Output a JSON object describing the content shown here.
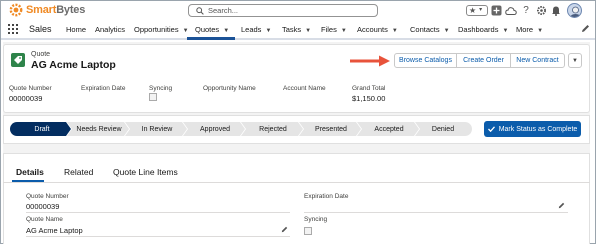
{
  "header": {
    "logo_text_orange": "Smart",
    "logo_text_gray": "Bytes",
    "search_placeholder": "Search...",
    "icons": [
      "favorites-star-icon",
      "favorites-dropdown-icon",
      "add-icon",
      "cloud-icon",
      "help-icon",
      "settings-gear-icon",
      "notifications-bell-icon",
      "user-avatar"
    ]
  },
  "nav": {
    "app_name": "Sales",
    "items": [
      {
        "label": "Home",
        "has_menu": false
      },
      {
        "label": "Analytics",
        "has_menu": false
      },
      {
        "label": "Opportunities",
        "has_menu": true
      },
      {
        "label": "Quotes",
        "has_menu": true,
        "active": true
      },
      {
        "label": "Leads",
        "has_menu": true
      },
      {
        "label": "Tasks",
        "has_menu": true
      },
      {
        "label": "Files",
        "has_menu": true
      },
      {
        "label": "Accounts",
        "has_menu": true
      },
      {
        "label": "Contacts",
        "has_menu": true
      },
      {
        "label": "Dashboards",
        "has_menu": true
      },
      {
        "label": "More",
        "has_menu": true
      }
    ]
  },
  "record": {
    "object_type": "Quote",
    "title": "AG Acme Laptop",
    "actions": [
      "Browse Catalogs",
      "Create Order",
      "New Contract"
    ],
    "fields": [
      {
        "label": "Quote Number",
        "value": "00000039"
      },
      {
        "label": "Expiration Date",
        "value": ""
      },
      {
        "label": "Syncing",
        "value": ""
      },
      {
        "label": "Opportunity Name",
        "value": ""
      },
      {
        "label": "Account Name",
        "value": ""
      },
      {
        "label": "Grand Total",
        "value": "$1,150.00"
      }
    ]
  },
  "path": {
    "stages": [
      "Draft",
      "Needs Review",
      "In Review",
      "Approved",
      "Rejected",
      "Presented",
      "Accepted",
      "Denied"
    ],
    "current_stage": "Draft",
    "mark_button": "Mark Status as Complete"
  },
  "tabs": {
    "items": [
      "Details",
      "Related",
      "Quote Line Items"
    ],
    "active": "Details"
  },
  "details": {
    "quote_number_label": "Quote Number",
    "quote_number_value": "00000039",
    "expiration_date_label": "Expiration Date",
    "expiration_date_value": "",
    "quote_name_label": "Quote Name",
    "quote_name_value": "AG Acme Laptop",
    "syncing_label": "Syncing"
  },
  "colors": {
    "brand_blue": "#0b5cab",
    "path_active": "#032d60",
    "path_inactive": "#e5e5e5",
    "quote_icon_green": "#2e844a",
    "annotation_arrow": "#e8533b",
    "logo_orange": "#f08a24"
  }
}
